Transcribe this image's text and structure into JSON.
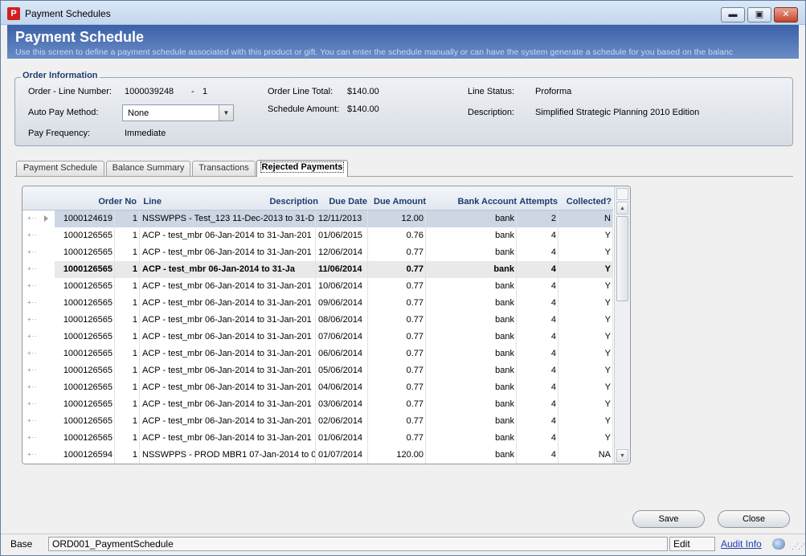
{
  "window": {
    "title": "Payment Schedules",
    "icon": "app-logo-icon",
    "controls": {
      "minimize": "▬",
      "maximize": "▣",
      "close": "✕"
    }
  },
  "banner": {
    "title": "Payment Schedule",
    "subtitle": "Use this screen to define a payment schedule associated with this product or gift. You can enter the schedule manually or can have the system generate a schedule for you based on the balanc"
  },
  "order_info": {
    "legend": "Order Information",
    "order_line_label": "Order - Line Number:",
    "order_number": "1000039248",
    "line_separator": "-",
    "line_number": "1",
    "order_line_total_label": "Order Line Total:",
    "order_line_total": "$140.00",
    "line_status_label": "Line Status:",
    "line_status": "Proforma",
    "auto_pay_label": "Auto Pay Method:",
    "auto_pay_value": "None",
    "schedule_amount_label": "Schedule Amount:",
    "schedule_amount": "$140.00",
    "description_label": "Description:",
    "description": "Simplified Strategic Planning 2010 Edition",
    "pay_frequency_label": "Pay Frequency:",
    "pay_frequency": "Immediate"
  },
  "tabs": [
    {
      "label": "Payment Schedule"
    },
    {
      "label": "Balance Summary"
    },
    {
      "label": "Transactions"
    },
    {
      "label": "Rejected Payments",
      "active": true
    }
  ],
  "grid": {
    "columns": [
      "Order No",
      "Line",
      "Description",
      "Due Date",
      "Due Amount",
      "Bank Account",
      "Attempts",
      "Collected?"
    ],
    "rows": [
      [
        "1000124619",
        "1",
        "NSSWPPS - Test_123 11-Dec-2013 to 31-D",
        "12/11/2013",
        "12.00",
        "bank",
        "2",
        "N"
      ],
      [
        "1000126565",
        "1",
        "ACP - test_mbr 06-Jan-2014 to 31-Jan-201",
        "01/06/2015",
        "0.76",
        "bank",
        "4",
        "Y"
      ],
      [
        "1000126565",
        "1",
        "ACP - test_mbr 06-Jan-2014 to 31-Jan-201",
        "12/06/2014",
        "0.77",
        "bank",
        "4",
        "Y"
      ],
      [
        "1000126565",
        "1",
        "ACP - test_mbr 06-Jan-2014 to 31-Ja",
        "11/06/2014",
        "0.77",
        "bank",
        "4",
        "Y"
      ],
      [
        "1000126565",
        "1",
        "ACP - test_mbr 06-Jan-2014 to 31-Jan-201",
        "10/06/2014",
        "0.77",
        "bank",
        "4",
        "Y"
      ],
      [
        "1000126565",
        "1",
        "ACP - test_mbr 06-Jan-2014 to 31-Jan-201",
        "09/06/2014",
        "0.77",
        "bank",
        "4",
        "Y"
      ],
      [
        "1000126565",
        "1",
        "ACP - test_mbr 06-Jan-2014 to 31-Jan-201",
        "08/06/2014",
        "0.77",
        "bank",
        "4",
        "Y"
      ],
      [
        "1000126565",
        "1",
        "ACP - test_mbr 06-Jan-2014 to 31-Jan-201",
        "07/06/2014",
        "0.77",
        "bank",
        "4",
        "Y"
      ],
      [
        "1000126565",
        "1",
        "ACP - test_mbr 06-Jan-2014 to 31-Jan-201",
        "06/06/2014",
        "0.77",
        "bank",
        "4",
        "Y"
      ],
      [
        "1000126565",
        "1",
        "ACP - test_mbr 06-Jan-2014 to 31-Jan-201",
        "05/06/2014",
        "0.77",
        "bank",
        "4",
        "Y"
      ],
      [
        "1000126565",
        "1",
        "ACP - test_mbr 06-Jan-2014 to 31-Jan-201",
        "04/06/2014",
        "0.77",
        "bank",
        "4",
        "Y"
      ],
      [
        "1000126565",
        "1",
        "ACP - test_mbr 06-Jan-2014 to 31-Jan-201",
        "03/06/2014",
        "0.77",
        "bank",
        "4",
        "Y"
      ],
      [
        "1000126565",
        "1",
        "ACP - test_mbr 06-Jan-2014 to 31-Jan-201",
        "02/06/2014",
        "0.77",
        "bank",
        "4",
        "Y"
      ],
      [
        "1000126565",
        "1",
        "ACP - test_mbr 06-Jan-2014 to 31-Jan-201",
        "01/06/2014",
        "0.77",
        "bank",
        "4",
        "Y"
      ],
      [
        "1000126594",
        "1",
        "NSSWPPS - PROD  MBR1 07-Jan-2014 to 0",
        "01/07/2014",
        "120.00",
        "bank",
        "4",
        "NA"
      ]
    ],
    "selected_row": 0,
    "bold_row": 3
  },
  "buttons": {
    "save": "Save",
    "close": "Close"
  },
  "status": {
    "base": "Base",
    "form_name": "ORD001_PaymentSchedule",
    "mode": "Edit",
    "audit_link": "Audit Info",
    "icon": "printer-icon"
  }
}
